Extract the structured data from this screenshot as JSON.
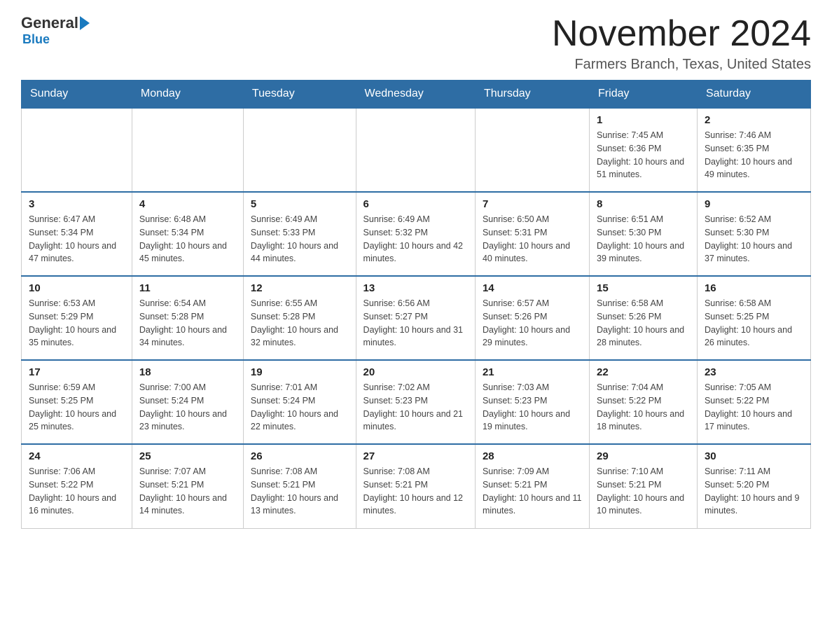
{
  "logo": {
    "general": "General",
    "blue": "Blue"
  },
  "header": {
    "title": "November 2024",
    "subtitle": "Farmers Branch, Texas, United States"
  },
  "weekdays": [
    "Sunday",
    "Monday",
    "Tuesday",
    "Wednesday",
    "Thursday",
    "Friday",
    "Saturday"
  ],
  "weeks": [
    [
      {
        "day": "",
        "info": ""
      },
      {
        "day": "",
        "info": ""
      },
      {
        "day": "",
        "info": ""
      },
      {
        "day": "",
        "info": ""
      },
      {
        "day": "",
        "info": ""
      },
      {
        "day": "1",
        "info": "Sunrise: 7:45 AM\nSunset: 6:36 PM\nDaylight: 10 hours and 51 minutes."
      },
      {
        "day": "2",
        "info": "Sunrise: 7:46 AM\nSunset: 6:35 PM\nDaylight: 10 hours and 49 minutes."
      }
    ],
    [
      {
        "day": "3",
        "info": "Sunrise: 6:47 AM\nSunset: 5:34 PM\nDaylight: 10 hours and 47 minutes."
      },
      {
        "day": "4",
        "info": "Sunrise: 6:48 AM\nSunset: 5:34 PM\nDaylight: 10 hours and 45 minutes."
      },
      {
        "day": "5",
        "info": "Sunrise: 6:49 AM\nSunset: 5:33 PM\nDaylight: 10 hours and 44 minutes."
      },
      {
        "day": "6",
        "info": "Sunrise: 6:49 AM\nSunset: 5:32 PM\nDaylight: 10 hours and 42 minutes."
      },
      {
        "day": "7",
        "info": "Sunrise: 6:50 AM\nSunset: 5:31 PM\nDaylight: 10 hours and 40 minutes."
      },
      {
        "day": "8",
        "info": "Sunrise: 6:51 AM\nSunset: 5:30 PM\nDaylight: 10 hours and 39 minutes."
      },
      {
        "day": "9",
        "info": "Sunrise: 6:52 AM\nSunset: 5:30 PM\nDaylight: 10 hours and 37 minutes."
      }
    ],
    [
      {
        "day": "10",
        "info": "Sunrise: 6:53 AM\nSunset: 5:29 PM\nDaylight: 10 hours and 35 minutes."
      },
      {
        "day": "11",
        "info": "Sunrise: 6:54 AM\nSunset: 5:28 PM\nDaylight: 10 hours and 34 minutes."
      },
      {
        "day": "12",
        "info": "Sunrise: 6:55 AM\nSunset: 5:28 PM\nDaylight: 10 hours and 32 minutes."
      },
      {
        "day": "13",
        "info": "Sunrise: 6:56 AM\nSunset: 5:27 PM\nDaylight: 10 hours and 31 minutes."
      },
      {
        "day": "14",
        "info": "Sunrise: 6:57 AM\nSunset: 5:26 PM\nDaylight: 10 hours and 29 minutes."
      },
      {
        "day": "15",
        "info": "Sunrise: 6:58 AM\nSunset: 5:26 PM\nDaylight: 10 hours and 28 minutes."
      },
      {
        "day": "16",
        "info": "Sunrise: 6:58 AM\nSunset: 5:25 PM\nDaylight: 10 hours and 26 minutes."
      }
    ],
    [
      {
        "day": "17",
        "info": "Sunrise: 6:59 AM\nSunset: 5:25 PM\nDaylight: 10 hours and 25 minutes."
      },
      {
        "day": "18",
        "info": "Sunrise: 7:00 AM\nSunset: 5:24 PM\nDaylight: 10 hours and 23 minutes."
      },
      {
        "day": "19",
        "info": "Sunrise: 7:01 AM\nSunset: 5:24 PM\nDaylight: 10 hours and 22 minutes."
      },
      {
        "day": "20",
        "info": "Sunrise: 7:02 AM\nSunset: 5:23 PM\nDaylight: 10 hours and 21 minutes."
      },
      {
        "day": "21",
        "info": "Sunrise: 7:03 AM\nSunset: 5:23 PM\nDaylight: 10 hours and 19 minutes."
      },
      {
        "day": "22",
        "info": "Sunrise: 7:04 AM\nSunset: 5:22 PM\nDaylight: 10 hours and 18 minutes."
      },
      {
        "day": "23",
        "info": "Sunrise: 7:05 AM\nSunset: 5:22 PM\nDaylight: 10 hours and 17 minutes."
      }
    ],
    [
      {
        "day": "24",
        "info": "Sunrise: 7:06 AM\nSunset: 5:22 PM\nDaylight: 10 hours and 16 minutes."
      },
      {
        "day": "25",
        "info": "Sunrise: 7:07 AM\nSunset: 5:21 PM\nDaylight: 10 hours and 14 minutes."
      },
      {
        "day": "26",
        "info": "Sunrise: 7:08 AM\nSunset: 5:21 PM\nDaylight: 10 hours and 13 minutes."
      },
      {
        "day": "27",
        "info": "Sunrise: 7:08 AM\nSunset: 5:21 PM\nDaylight: 10 hours and 12 minutes."
      },
      {
        "day": "28",
        "info": "Sunrise: 7:09 AM\nSunset: 5:21 PM\nDaylight: 10 hours and 11 minutes."
      },
      {
        "day": "29",
        "info": "Sunrise: 7:10 AM\nSunset: 5:21 PM\nDaylight: 10 hours and 10 minutes."
      },
      {
        "day": "30",
        "info": "Sunrise: 7:11 AM\nSunset: 5:20 PM\nDaylight: 10 hours and 9 minutes."
      }
    ]
  ]
}
